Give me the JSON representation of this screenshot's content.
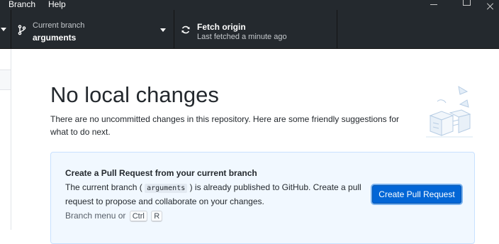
{
  "menubar": {
    "items": [
      {
        "label": "Branch"
      },
      {
        "label": "Help"
      }
    ]
  },
  "toolbar": {
    "current_branch": {
      "label": "Current branch",
      "value": "arguments"
    },
    "fetch": {
      "label": "Fetch origin",
      "value": "Last fetched a minute ago"
    }
  },
  "main": {
    "title": "No local changes",
    "description": "There are no uncommitted changes in this repository. Here are some friendly suggestions for what to do next.",
    "suggestion": {
      "title": "Create a Pull Request from your current branch",
      "desc_before": "The current branch (",
      "branch_code": "arguments",
      "desc_after": ") is already published to GitHub. Create a pull request to propose and collaborate on your changes.",
      "hint_prefix": "Branch menu or",
      "shortcut_keys": [
        "Ctrl",
        "R"
      ],
      "button_label": "Create Pull Request"
    }
  },
  "colors": {
    "toolbar_bg": "#24292e",
    "accent": "#0366d6",
    "suggestion_bg": "#f1f8ff"
  },
  "icons": {
    "branch": "git-branch-icon",
    "fetch": "sync-icon"
  }
}
